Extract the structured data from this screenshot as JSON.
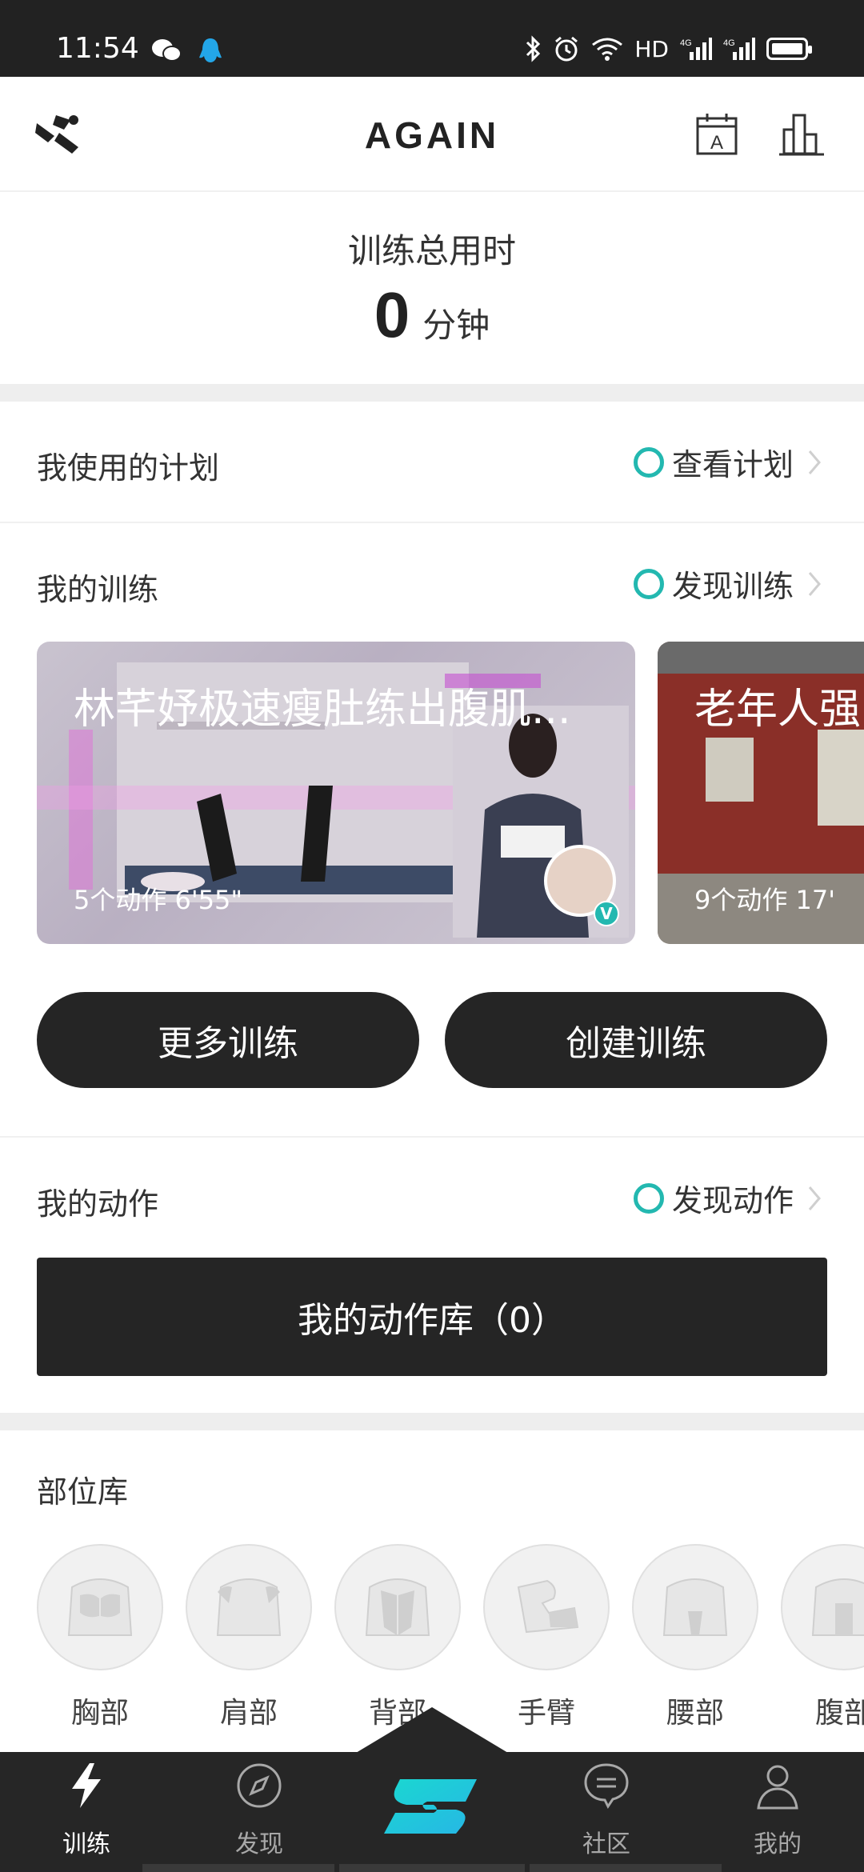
{
  "status_bar": {
    "time": "11:54",
    "network_label": "HD",
    "icons": [
      "wechat-icon",
      "qq-icon",
      "bluetooth-icon",
      "alarm-icon",
      "wifi-icon",
      "signal-4g-icon",
      "signal-4g-icon",
      "battery-icon"
    ]
  },
  "header": {
    "brand": "AGAIN",
    "calendar_letter": "A"
  },
  "total": {
    "label": "训练总用时",
    "value": "0",
    "unit": "分钟"
  },
  "plans": {
    "title": "我使用的计划",
    "link": "查看计划"
  },
  "trainings": {
    "title": "我的训练",
    "link": "发现训练",
    "cards": [
      {
        "title": "林芊妤极速瘦肚练出腹肌...",
        "meta": "5个动作   6'55\""
      },
      {
        "title": "老年人强",
        "meta": "9个动作   17'"
      }
    ],
    "more_label": "更多训练",
    "create_label": "创建训练"
  },
  "actions": {
    "title": "我的动作",
    "link": "发现动作",
    "library_label": "我的动作库（0）"
  },
  "body_parts": {
    "title": "部位库",
    "items": [
      {
        "label": "胸部"
      },
      {
        "label": "肩部"
      },
      {
        "label": "背部"
      },
      {
        "label": "手臂"
      },
      {
        "label": "腰部"
      },
      {
        "label": "腹部"
      }
    ]
  },
  "tabbar": {
    "tabs": [
      {
        "label": "训练",
        "icon": "lightning-icon",
        "active": true
      },
      {
        "label": "发现",
        "icon": "compass-icon",
        "active": false
      },
      {
        "label": "",
        "icon": "again-logo-icon",
        "active": false
      },
      {
        "label": "社区",
        "icon": "chat-icon",
        "active": false
      },
      {
        "label": "我的",
        "icon": "person-icon",
        "active": false
      }
    ]
  },
  "colors": {
    "accent": "#23b8b0",
    "dark": "#252525",
    "band": "#eeeeee"
  }
}
